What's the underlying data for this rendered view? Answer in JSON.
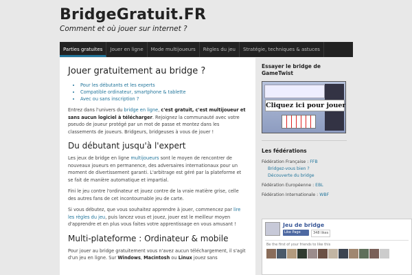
{
  "header": {
    "site_title": "BridgeGratuit.FR",
    "tagline": "Comment et où jouer sur internet ?"
  },
  "nav": {
    "items": [
      {
        "label": "Parties gratuites",
        "active": true
      },
      {
        "label": "Jouer en ligne"
      },
      {
        "label": "Mode multijoueurs"
      },
      {
        "label": "Règles du jeu"
      },
      {
        "label": "Stratégie, techniques & astuces"
      }
    ]
  },
  "main": {
    "title": "Jouer gratuitement au bridge ?",
    "bullets": [
      "Pour les débutants et les experts",
      "Compatible ordinateur, smartphone & tablette",
      "Avec ou sans inscription ?"
    ],
    "intro": {
      "t1": "Entrez dans l'univers du ",
      "l1": "bridge en ligne",
      "t2": ", ",
      "b1": "c'est gratuit, c'est multijoueur et sans aucun logiciel à télécharger",
      "t3": ". Rejoignez la communauté avec votre pseudo de joueur protégé par un mot de passe et montez dans les classements de joueurs. Bridgeurs, bridgeuses à vous de jouer !"
    },
    "section2_title": "Du débutant jusqu'à l'expert",
    "p2": {
      "t1": "Les jeux de bridge en ligne ",
      "l1": "multijoueurs",
      "t2": " sont le moyen de rencontrer de nouveaux joueurs en permanence, des adversaires internationaux pour un moment de divertissement garanti. L'arbitrage est géré par la plateforme et se fait de manière automatique et impartial."
    },
    "p3": "Fini le jeu contre l'ordinateur et jouez contre de la vraie matière grise, celle des autres fans de cet incontournable jeu de carte.",
    "p4": {
      "t1": "Si vous débutez, que vous souhaitez apprendre à jouer, commencez par ",
      "l1": "lire les règles du jeu",
      "t2": ", puis lancez vous et jouez, jouer est le meilleur moyen d'apprendre et en plus vous faites votre apprentissage en vous amusant !"
    },
    "section3_title": "Multi-plateforme : Ordinateur & mobile",
    "p5": {
      "t1": "Pour jouer au bridge gratuitement vous n'avez aucun téléchargement, il s'agit d'un jeu en ligne. Sur ",
      "b1": "Windows",
      "t2": ", ",
      "b2": "Macintosh",
      "t3": " ou ",
      "b3": "Linux",
      "t4": " jouez sans "
    }
  },
  "sidebar": {
    "promo_title": "Essayer le bridge de GameTwist",
    "promo_cta": "Cliquez ici pour jouer",
    "federations_title": "Les fédérations",
    "federations": {
      "fr_label": "Fédération Française : ",
      "fr_link": "FFB",
      "fr_sub1": "Bridgez-vous bien ?",
      "fr_sub2": "Découverte du bridge",
      "eu_label": "Fédération Européenne : ",
      "eu_link": "EBL",
      "intl_label": "Fédération Internationale : ",
      "intl_link": "WBF"
    }
  },
  "facebook": {
    "page_name": "Jeu de bridge",
    "like_label": "Like Page",
    "likes_count": "348 likes",
    "friends_text": "Be the first of your friends to like this"
  },
  "colors": {
    "link": "#21759b",
    "nav_bg": "#222222",
    "page_bg": "#e8e8e8"
  }
}
